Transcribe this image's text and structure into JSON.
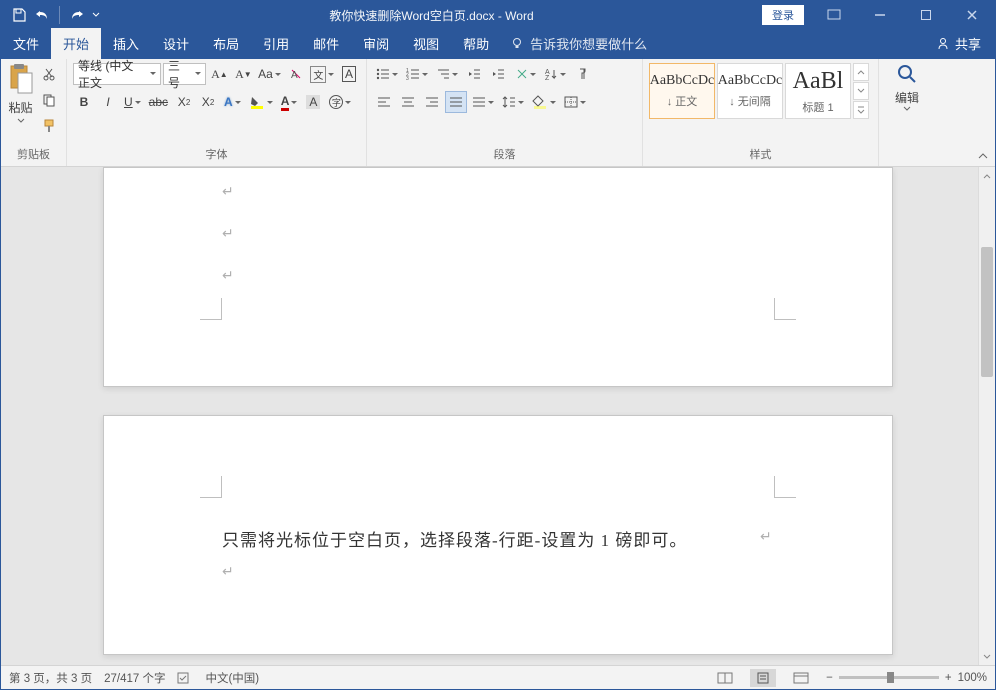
{
  "title": "教你快速删除Word空白页.docx - Word",
  "login": "登录",
  "menu": {
    "file": "文件",
    "home": "开始",
    "insert": "插入",
    "design": "设计",
    "layout": "布局",
    "references": "引用",
    "mail": "邮件",
    "review": "审阅",
    "view": "视图",
    "help": "帮助",
    "tellme": "告诉我你想要做什么",
    "share": "共享"
  },
  "ribbon": {
    "clipboard": {
      "label": "剪贴板",
      "paste": "粘贴"
    },
    "font": {
      "label": "字体",
      "family": "等线 (中文正文",
      "size": "三号"
    },
    "paragraph": {
      "label": "段落"
    },
    "styles": {
      "label": "样式",
      "items": [
        {
          "preview": "AaBbCcDc",
          "name": "↓ 正文"
        },
        {
          "preview": "AaBbCcDc",
          "name": "↓ 无间隔"
        },
        {
          "preview": "AaBl",
          "name": "标题 1"
        }
      ]
    },
    "editing": {
      "label": "编辑"
    }
  },
  "document": {
    "para_mark": "↵",
    "body_text": "只需将光标位于空白页，选择段落-行距-设置为 1 磅即可。",
    "trail_mark": "↵"
  },
  "status": {
    "page": "第 3 页，共 3 页",
    "words": "27/417 个字",
    "lang_label": "中文(中国)",
    "zoom": "100%"
  }
}
